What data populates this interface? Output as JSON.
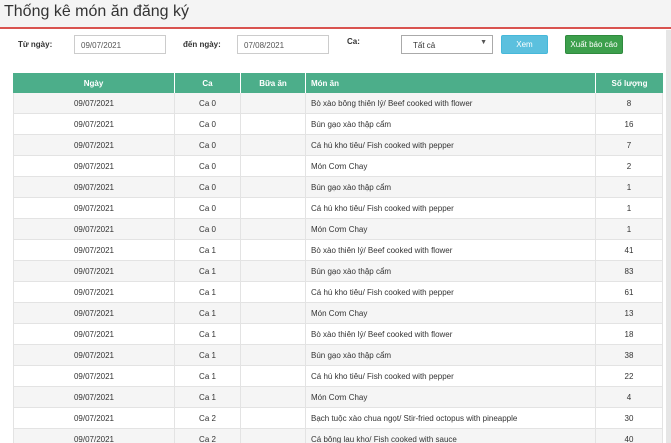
{
  "header": {
    "title": "Thống kê món ăn đăng ký"
  },
  "filters": {
    "from_label": "Từ ngày:",
    "from_value": "09/07/2021",
    "to_label": "đến ngày:",
    "to_value": "07/08/2021",
    "shift_label": "Ca:",
    "shift_value": "Tất cả",
    "view_button": "Xem",
    "export_button": "Xuất báo cáo"
  },
  "colors": {
    "header_green": "#4cae8a",
    "accent_red": "#d9534f",
    "view_blue": "#5bc0de",
    "export_green": "#3c9f4c"
  },
  "table": {
    "columns": [
      "Ngày",
      "Ca",
      "Bữa ăn",
      "Món ăn",
      "Số lượng"
    ],
    "rows": [
      [
        "09/07/2021",
        "Ca 0",
        "",
        "Bò xào bông thiên lý/ Beef cooked with flower",
        "8"
      ],
      [
        "09/07/2021",
        "Ca 0",
        "",
        "Bún gạo xào thập cẩm",
        "16"
      ],
      [
        "09/07/2021",
        "Ca 0",
        "",
        "Cá hú kho tiêu/ Fish cooked with pepper",
        "7"
      ],
      [
        "09/07/2021",
        "Ca 0",
        "",
        "Món Cơm Chay",
        "2"
      ],
      [
        "09/07/2021",
        "Ca 0",
        "",
        "Bún gạo xào thập cẩm",
        "1"
      ],
      [
        "09/07/2021",
        "Ca 0",
        "",
        "Cá hú kho tiêu/ Fish cooked with pepper",
        "1"
      ],
      [
        "09/07/2021",
        "Ca 0",
        "",
        "Món Cơm Chay",
        "1"
      ],
      [
        "09/07/2021",
        "Ca 1",
        "",
        "Bò xào thiên lý/ Beef cooked with flower",
        "41"
      ],
      [
        "09/07/2021",
        "Ca 1",
        "",
        "Bún gạo xào thập cẩm",
        "83"
      ],
      [
        "09/07/2021",
        "Ca 1",
        "",
        "Cá hú kho tiêu/ Fish cooked with pepper",
        "61"
      ],
      [
        "09/07/2021",
        "Ca 1",
        "",
        "Món Cơm Chay",
        "13"
      ],
      [
        "09/07/2021",
        "Ca 1",
        "",
        "Bò xào thiên lý/ Beef cooked with flower",
        "18"
      ],
      [
        "09/07/2021",
        "Ca 1",
        "",
        "Bún gạo xào thập cẩm",
        "38"
      ],
      [
        "09/07/2021",
        "Ca 1",
        "",
        "Cá hú kho tiêu/ Fish cooked with pepper",
        "22"
      ],
      [
        "09/07/2021",
        "Ca 1",
        "",
        "Món Cơm Chay",
        "4"
      ],
      [
        "09/07/2021",
        "Ca 2",
        "",
        "Bạch tuộc xào chua ngọt/ Stir-fried octopus with pineapple",
        "30"
      ],
      [
        "09/07/2021",
        "Ca 2",
        "",
        "Cá bông lau kho/ Fish cooked with sauce",
        "40"
      ]
    ]
  }
}
